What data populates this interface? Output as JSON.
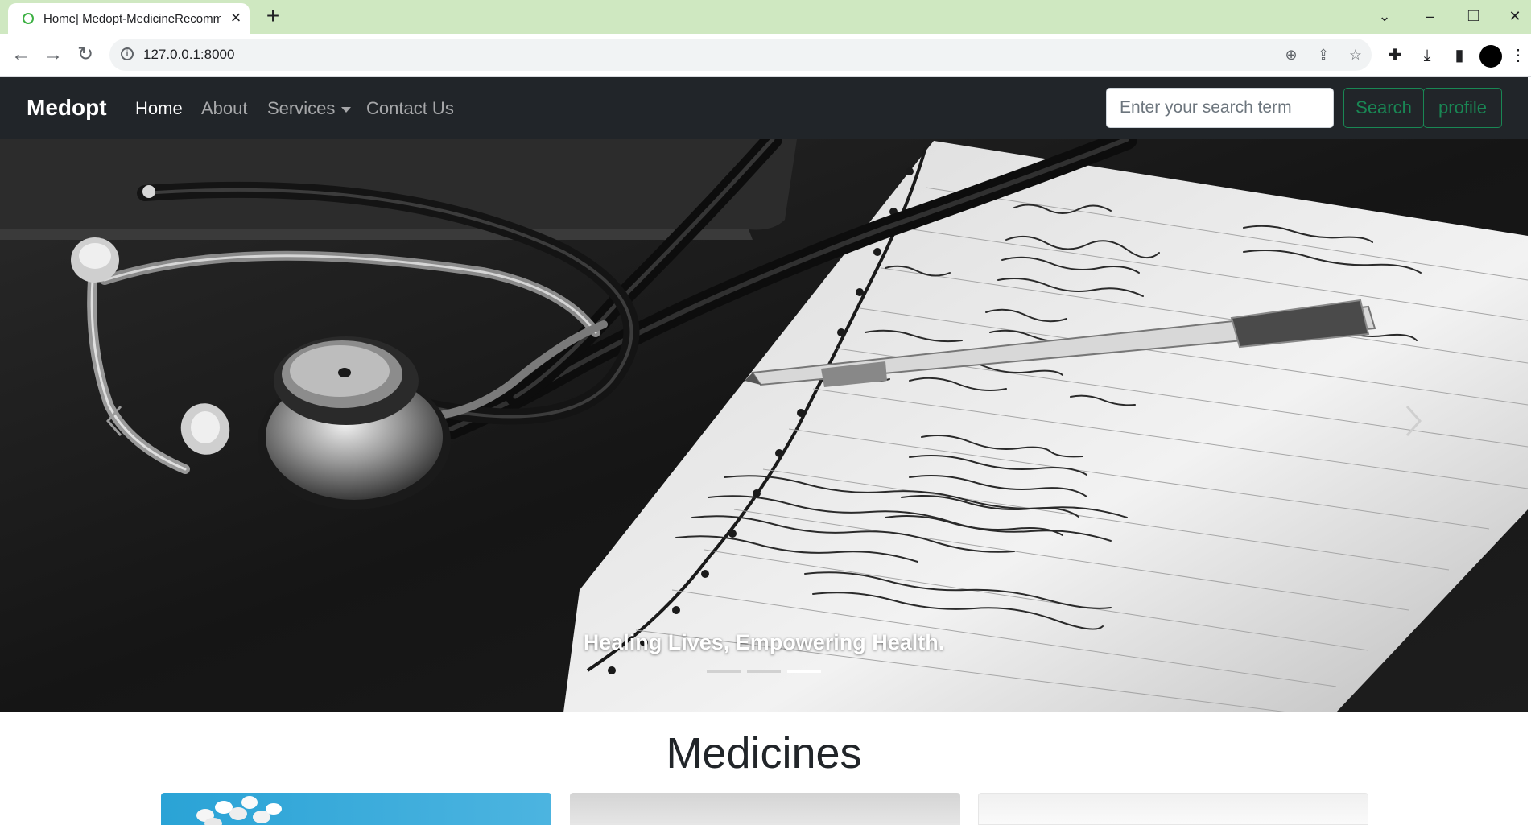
{
  "browser": {
    "tab_title": "Home| Medopt-MedicineRecomm",
    "url": "127.0.0.1:8000"
  },
  "navbar": {
    "brand": "Medopt",
    "links": [
      {
        "label": "Home"
      },
      {
        "label": "About"
      },
      {
        "label": "Services"
      },
      {
        "label": "Contact Us"
      }
    ],
    "search_placeholder": "Enter your search term",
    "search_button": "Search",
    "profile_button": "profile"
  },
  "hero": {
    "caption": "Healing Lives, Empowering Health.",
    "slide_count": 3,
    "active_slide": 3
  },
  "main": {
    "section_title": "Medicines"
  },
  "colors": {
    "tab_strip": "#cfe8c1",
    "navbar_bg": "#212529",
    "accent_green": "#198754"
  }
}
